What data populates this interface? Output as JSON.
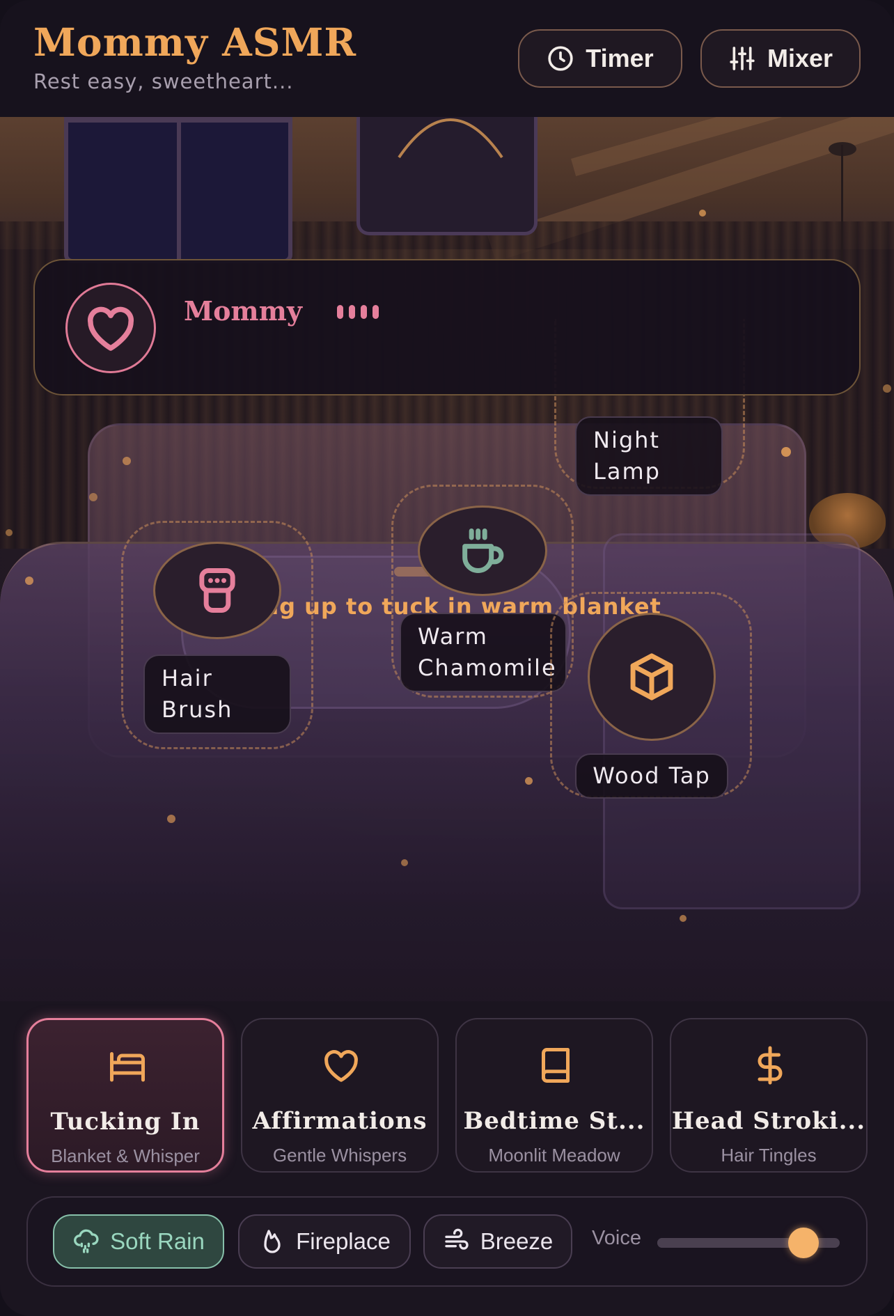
{
  "header": {
    "title": "Mommy ASMR",
    "subtitle": "Rest easy, sweetheart...",
    "timer_label": "Timer",
    "mixer_label": "Mixer"
  },
  "companion": {
    "name": "Mommy",
    "status": "typing"
  },
  "room": {
    "blanket_hint": "Drag up to tuck in warm blanket",
    "props": [
      {
        "label": "Night Lamp",
        "icon": "lamp-icon"
      },
      {
        "label": "Warm Chamomile",
        "icon": "tea-cup-icon",
        "color": "#7fae9a"
      },
      {
        "label": "Hair Brush",
        "icon": "hair-brush-icon",
        "color": "#e57f9b"
      },
      {
        "label": "Wood Tap",
        "icon": "wood-block-icon",
        "color": "#f0a75a"
      }
    ]
  },
  "scenes": [
    {
      "title": "Tucking In",
      "subtitle": "Blanket & Whisper",
      "icon": "bed-icon",
      "active": true
    },
    {
      "title": "Affirmations",
      "subtitle": "Gentle Whispers",
      "icon": "heart-icon",
      "active": false
    },
    {
      "title": "Bedtime St...",
      "subtitle": "Moonlit Meadow",
      "icon": "book-icon",
      "active": false
    },
    {
      "title": "Head Stroki...",
      "subtitle": "Hair Tingles",
      "icon": "dollar-icon",
      "active": false
    }
  ],
  "ambient": {
    "chips": [
      {
        "label": "Soft Rain",
        "icon": "rain-cloud-icon",
        "active": true
      },
      {
        "label": "Fireplace",
        "icon": "flame-icon",
        "active": false
      },
      {
        "label": "Breeze",
        "icon": "wind-icon",
        "active": false
      }
    ],
    "voice_label": "Voice",
    "voice_level": 0.8
  },
  "colors": {
    "accent": "#f0a75a",
    "pink": "#e57f9b",
    "mint": "#87c0aa",
    "background": "#1b1520"
  }
}
